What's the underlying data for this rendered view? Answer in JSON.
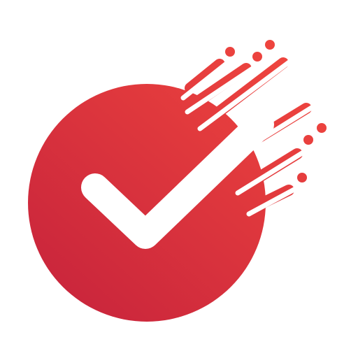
{
  "logo": {
    "icon": "fast-checkmark-icon",
    "colors": {
      "gradient_top": "#F0463E",
      "gradient_bottom": "#C8243C",
      "mark": "#FFFFFF",
      "background": "#FFFFFF"
    }
  }
}
